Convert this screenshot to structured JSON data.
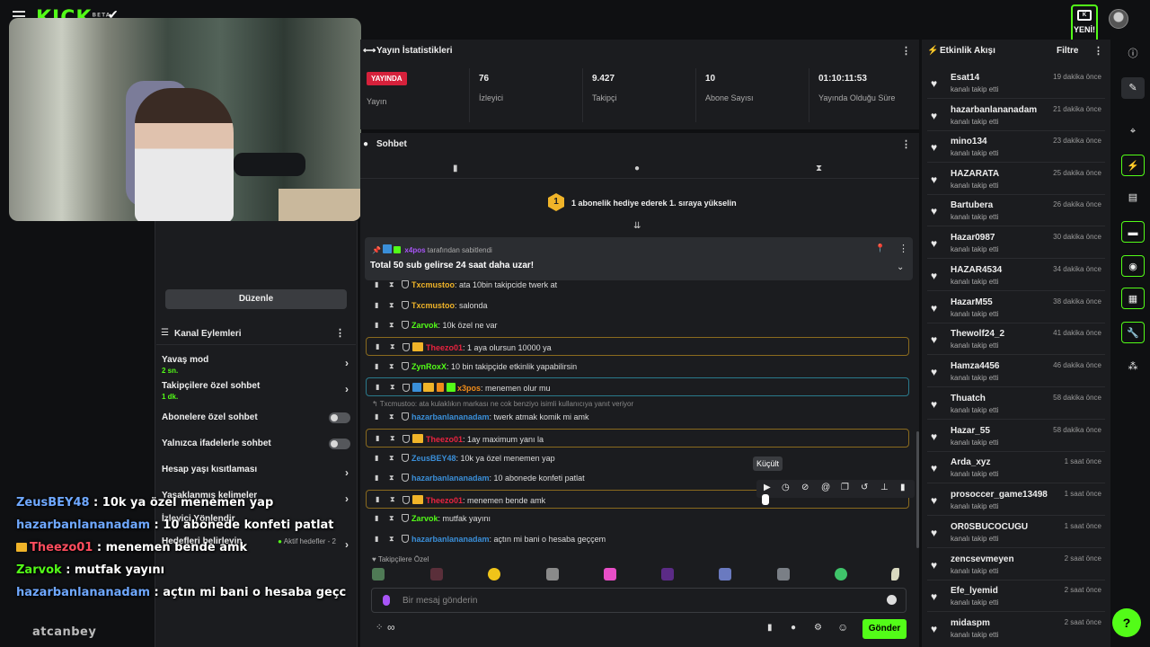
{
  "header": {
    "logo": "KICK",
    "logo_sup": "BETA",
    "new_badge": "YENİ!"
  },
  "stats": {
    "title": "Yayın İstatistikleri",
    "live_badge": "YAYINDA",
    "live_label": "Yayın",
    "items": [
      {
        "value": "76",
        "label": "İzleyici"
      },
      {
        "value": "9.427",
        "label": "Takipçi"
      },
      {
        "value": "10",
        "label": "Abone Sayısı"
      },
      {
        "value": "01:10:11:53",
        "label": "Yayında Olduğu Süre"
      }
    ]
  },
  "chat": {
    "title": "Sohbet",
    "gift_rank": "1",
    "gift_text": "1 abonelik hediye ederek 1. sıraya yükselin",
    "pinned_user": "x4pos",
    "pinned_by_suffix": "tarafından sabitlendi",
    "pinned_message": "Total 50 sub gelirse 24 saat daha uzar!",
    "reply_note": "Txcmustoo: ata kulaklıkın markası ne cok benziyo isimli kullanıcıya yanıt veriyor",
    "tooltip": "Küçült",
    "subs_only_label": "Takipçilere Özel",
    "input_placeholder": "Bir mesaj gönderin",
    "send_label": "Gönder",
    "infinity": "∞",
    "messages": [
      {
        "user": "Txcmustoo",
        "color": "#f0b429",
        "text": ": ata 10bin takipcide twerk at"
      },
      {
        "user": "Txcmustoo",
        "color": "#f0b429",
        "text": ": salonda"
      },
      {
        "user": "Zarvok",
        "color": "#53fc18",
        "text": ": 10k özel ne var"
      },
      {
        "user": "Theezo01",
        "color": "#e8233f",
        "text": ": 1 aya olursun 10000 ya"
      },
      {
        "user": "ZynRoxX",
        "color": "#53fc18",
        "text": ": 10 bin takipçide etkinlik yapabilirsin"
      },
      {
        "user": "x3pos",
        "color": "#f08c19",
        "text": ": menemen olur mu"
      },
      {
        "user": "hazarbanlananadam",
        "color": "#3a8fd9",
        "text": ": twerk atmak komik mi amk"
      },
      {
        "user": "Theezo01",
        "color": "#e8233f",
        "text": ": 1ay maximum yanı la"
      },
      {
        "user": "ZeusBEY48",
        "color": "#3a8fd9",
        "text": ": 10k ya özel menemen yap"
      },
      {
        "user": "hazarbanlananadam",
        "color": "#3a8fd9",
        "text": ": 10 abonede konfeti patlat"
      },
      {
        "user": "Theezo01",
        "color": "#e8233f",
        "text": ": menemen bende amk"
      },
      {
        "user": "Zarvok",
        "color": "#53fc18",
        "text": ": mutfak yayını"
      },
      {
        "user": "hazarbanlananadam",
        "color": "#3a8fd9",
        "text": ": açtın mi bani o hesaba geççem"
      }
    ]
  },
  "channel_actions": {
    "edit_button": "Düzenle",
    "title": "Kanal Eylemleri",
    "items": [
      {
        "label": "Yavaş mod",
        "sub": "2 sn."
      },
      {
        "label": "Takipçilere özel sohbet",
        "sub": "1 dk."
      },
      {
        "label": "Abonelere özel sohbet"
      },
      {
        "label": "Yalnızca ifadelerle sohbet"
      },
      {
        "label": "Hesap yaşı kısıtlaması"
      },
      {
        "label": "Yasaklanmış kelimeler"
      },
      {
        "label": "İzleyici Yönlendir"
      },
      {
        "label": "Hedefleri belirleyin",
        "extra": "Aktif hedefler - 2"
      }
    ]
  },
  "overlay_chat": [
    {
      "user": "ZeusBEY48",
      "color": "#6fa8ff",
      "text": " : 10k ya özel menemen yap"
    },
    {
      "user": "hazarbanlananadam",
      "color": "#6fa8ff",
      "text": " : 10 abonede konfeti patlat"
    },
    {
      "user": "Theezo01",
      "color": "#ff4d5e",
      "text": " : menemen bende amk"
    },
    {
      "user": "Zarvok",
      "color": "#53fc18",
      "text": " : mutfak yayını"
    },
    {
      "user": "hazarbanlananadam",
      "color": "#6fa8ff",
      "text": " : açtın mi bani o hesaba geçc"
    }
  ],
  "watermark": "atcanbey",
  "feed": {
    "title": "Etkinlik Akışı",
    "filter": "Filtre",
    "items": [
      {
        "name": "Esat14",
        "desc": "kanalı takip etti",
        "time": "19 dakika önce"
      },
      {
        "name": "hazarbanlananadam",
        "desc": "kanalı takip etti",
        "time": "21 dakika önce"
      },
      {
        "name": "mino134",
        "desc": "kanalı takip etti",
        "time": "23 dakika önce"
      },
      {
        "name": "HAZARATA",
        "desc": "kanalı takip etti",
        "time": "25 dakika önce"
      },
      {
        "name": "Bartubera",
        "desc": "kanalı takip etti",
        "time": "26 dakika önce"
      },
      {
        "name": "Hazar0987",
        "desc": "kanalı takip etti",
        "time": "30 dakika önce"
      },
      {
        "name": "HAZAR4534",
        "desc": "kanalı takip etti",
        "time": "34 dakika önce"
      },
      {
        "name": "HazarM55",
        "desc": "kanalı takip etti",
        "time": "38 dakika önce"
      },
      {
        "name": "Thewolf24_2",
        "desc": "kanalı takip etti",
        "time": "41 dakika önce"
      },
      {
        "name": "Hamza4456",
        "desc": "kanalı takip etti",
        "time": "46 dakika önce"
      },
      {
        "name": "Thuatch",
        "desc": "kanalı takip etti",
        "time": "58 dakika önce"
      },
      {
        "name": "Hazar_55",
        "desc": "kanalı takip etti",
        "time": "58 dakika önce"
      },
      {
        "name": "Arda_xyz",
        "desc": "kanalı takip etti",
        "time": "1 saat önce"
      },
      {
        "name": "prosoccer_game13498",
        "desc": "kanalı takip etti",
        "time": "1 saat önce"
      },
      {
        "name": "OR0SBUCOCUGU",
        "desc": "kanalı takip etti",
        "time": "1 saat önce"
      },
      {
        "name": "zencsevmeyen",
        "desc": "kanalı takip etti",
        "time": "2 saat önce"
      },
      {
        "name": "Efe_lyemid",
        "desc": "kanalı takip etti",
        "time": "2 saat önce"
      },
      {
        "name": "midaspm",
        "desc": "kanalı takip etti",
        "time": "2 saat önce"
      }
    ]
  }
}
